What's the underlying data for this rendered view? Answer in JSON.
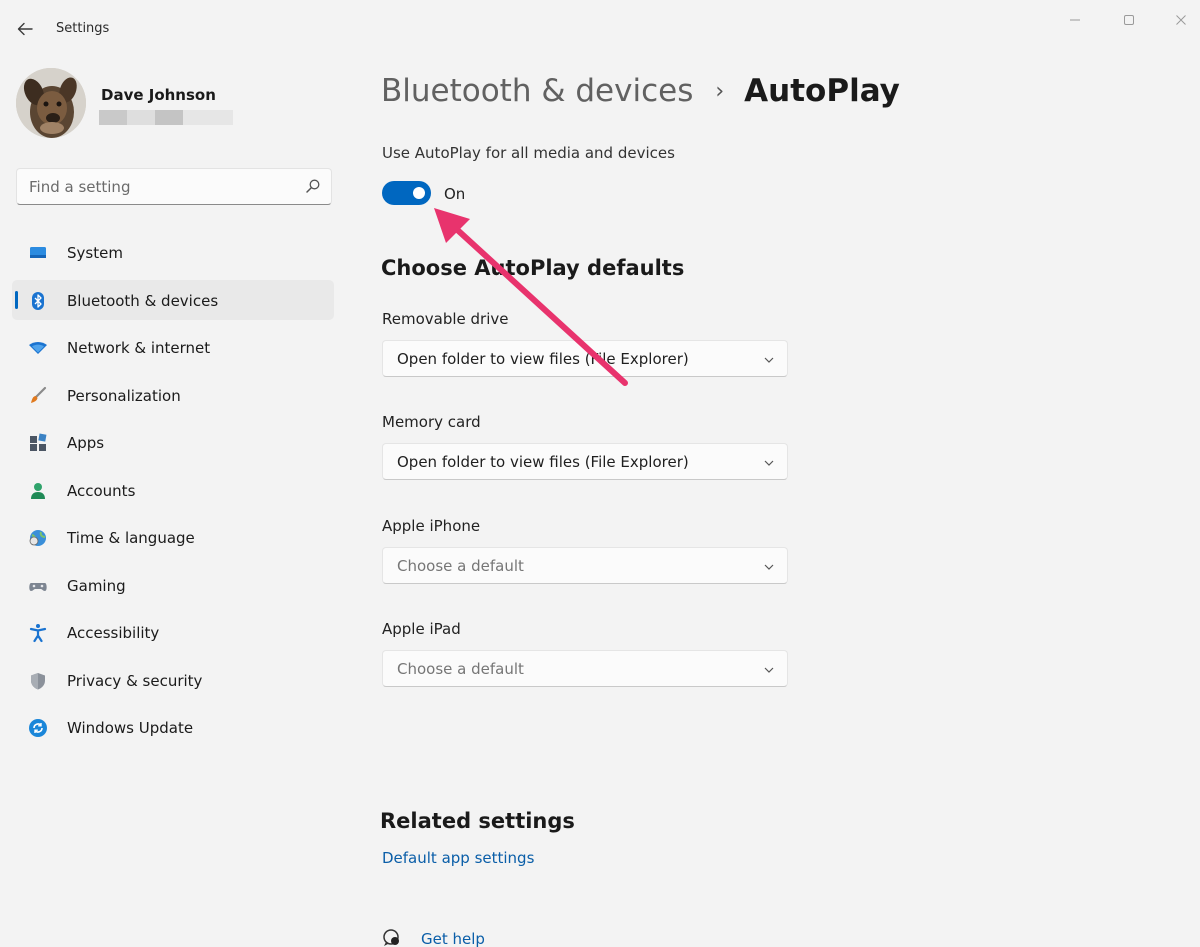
{
  "window": {
    "title": "Settings"
  },
  "profile": {
    "name": "Dave Johnson"
  },
  "search": {
    "placeholder": "Find a setting"
  },
  "sidebar": {
    "items": [
      {
        "label": "System",
        "icon": "monitor-icon",
        "active": false
      },
      {
        "label": "Bluetooth & devices",
        "icon": "bluetooth-icon",
        "active": true
      },
      {
        "label": "Network & internet",
        "icon": "wifi-icon",
        "active": false
      },
      {
        "label": "Personalization",
        "icon": "brush-icon",
        "active": false
      },
      {
        "label": "Apps",
        "icon": "apps-icon",
        "active": false
      },
      {
        "label": "Accounts",
        "icon": "person-icon",
        "active": false
      },
      {
        "label": "Time & language",
        "icon": "globe-clock-icon",
        "active": false
      },
      {
        "label": "Gaming",
        "icon": "gamepad-icon",
        "active": false
      },
      {
        "label": "Accessibility",
        "icon": "accessibility-icon",
        "active": false
      },
      {
        "label": "Privacy & security",
        "icon": "shield-icon",
        "active": false
      },
      {
        "label": "Windows Update",
        "icon": "update-icon",
        "active": false
      }
    ]
  },
  "main": {
    "breadcrumb": {
      "parent": "Bluetooth & devices",
      "separator": "›",
      "current": "AutoPlay"
    },
    "autoplay_toggle": {
      "caption": "Use AutoPlay for all media and devices",
      "state": "On",
      "enabled": true
    },
    "defaults_title": "Choose AutoPlay defaults",
    "fields": [
      {
        "label": "Removable drive",
        "value": "Open folder to view files (File Explorer)",
        "placeholder": false
      },
      {
        "label": "Memory card",
        "value": "Open folder to view files (File Explorer)",
        "placeholder": false
      },
      {
        "label": "Apple iPhone",
        "value": "Choose a default",
        "placeholder": true
      },
      {
        "label": "Apple iPad",
        "value": "Choose a default",
        "placeholder": true
      }
    ],
    "related_title": "Related settings",
    "related_link": "Default app settings",
    "help_link": "Get help"
  },
  "colors": {
    "accent": "#0067c0",
    "link": "#0a5ea8",
    "annotation_arrow": "#e8336d",
    "background": "#f3f3f3"
  }
}
